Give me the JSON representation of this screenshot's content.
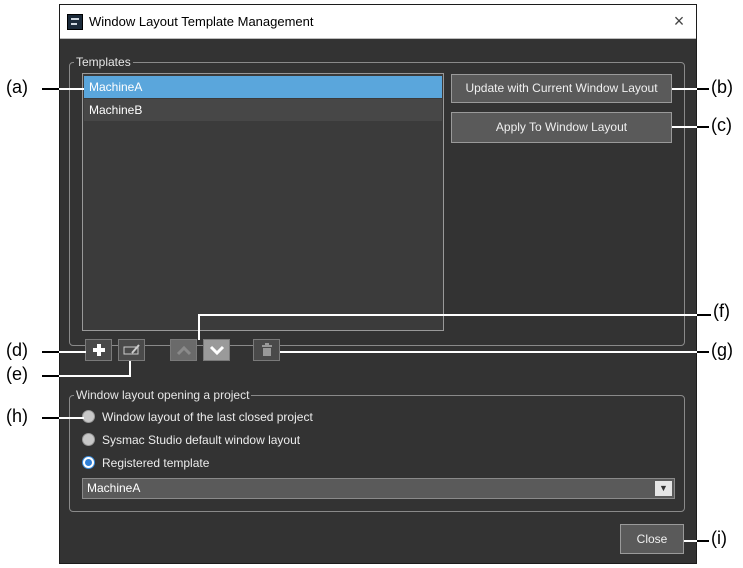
{
  "window": {
    "title": "Window Layout Template Management",
    "close_glyph": "×"
  },
  "templates": {
    "legend": "Templates",
    "items": [
      "MachineA",
      "MachineB"
    ],
    "selected_index": 0,
    "update_button": "Update with Current Window Layout",
    "apply_button": "Apply To Window Layout"
  },
  "toolbar": {
    "add_icon": "plus-icon",
    "rename_icon": "rename-icon",
    "up_icon": "chevron-up-icon",
    "down_icon": "chevron-down-icon",
    "delete_icon": "trash-icon"
  },
  "opening": {
    "legend": "Window layout opening a project",
    "options": [
      "Window layout of the last closed project",
      "Sysmac Studio default window layout",
      "Registered template"
    ],
    "selected_index": 2,
    "template_value": "MachineA",
    "dropdown_arrow": "▼"
  },
  "footer": {
    "close_button": "Close"
  },
  "callouts": {
    "a": "(a)",
    "b": "(b)",
    "c": "(c)",
    "d": "(d)",
    "e": "(e)",
    "f": "(f)",
    "g": "(g)",
    "h": "(h)",
    "i": "(i)"
  },
  "colors": {
    "dialog_bg": "#333333",
    "selection": "#5aa6dc",
    "radio_accent": "#2f7fd6"
  }
}
